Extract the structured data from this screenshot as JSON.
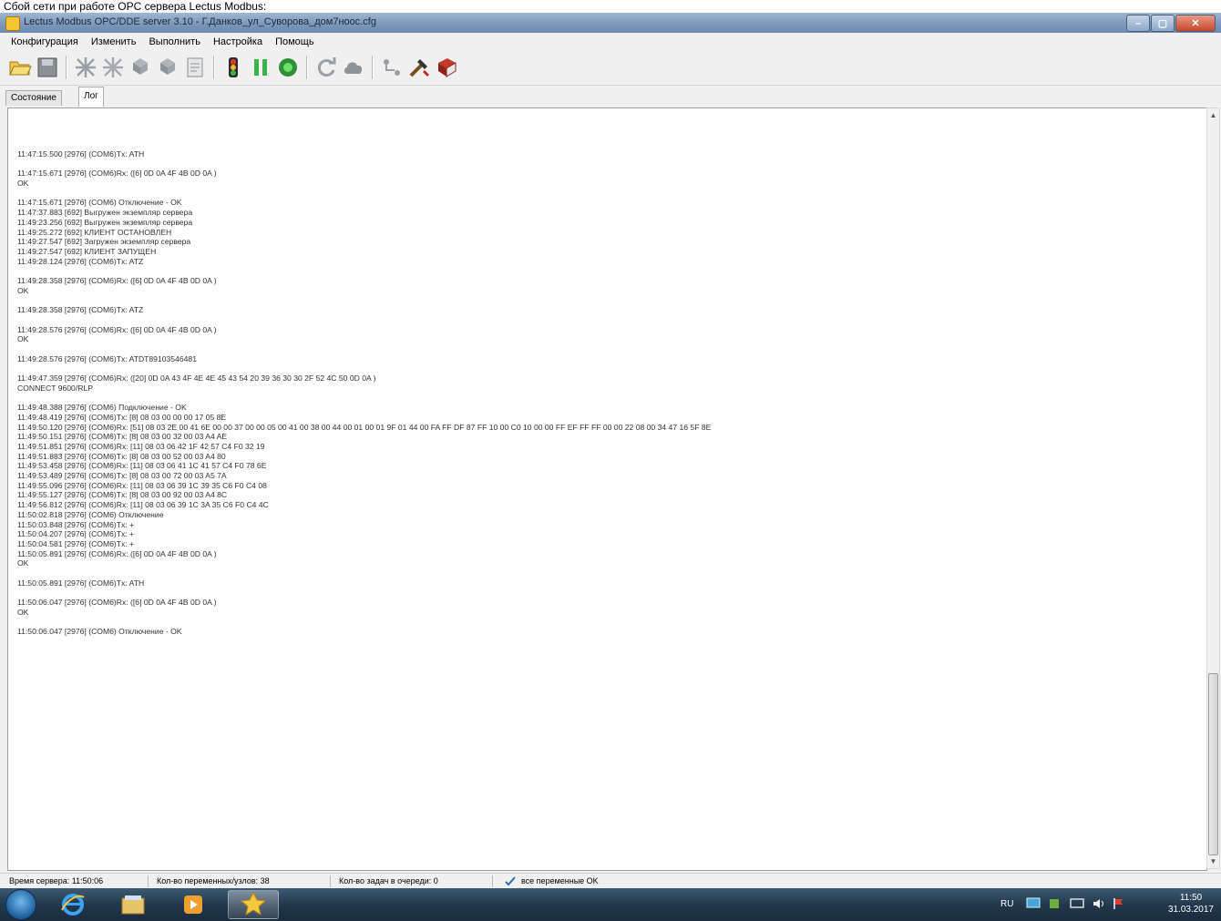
{
  "top_strip_text": "Сбой сети при работе OPC сервера Lectus Modbus:",
  "window": {
    "title": "Lectus Modbus OPC/DDE server 3.10 - Г.Данков_ул_Суворова_дом7ноос.cfg",
    "controls": {
      "minimize": "–",
      "maximize": "▢",
      "close": "✕"
    }
  },
  "menu": [
    "Конфигурация",
    "Изменить",
    "Выполнить",
    "Настройка",
    "Помощь"
  ],
  "toolbar_icons": [
    "open-folder-icon",
    "save-icon",
    "gear-cross-icon",
    "gear-cross-icon-2",
    "device-icon",
    "device-icon-2",
    "report-icon",
    "traffic-light-icon",
    "pause-icon",
    "record-icon",
    "refresh-icon",
    "cloud-icon",
    "network-icon",
    "tools-icon",
    "help-book-icon"
  ],
  "tabs": [
    {
      "label": "Состояние",
      "active": false
    },
    {
      "label": "Лог",
      "active": true
    }
  ],
  "log_lines": [
    "11:47:15.500 [2976] (COM6)Tx: ATH",
    "",
    "11:47:15.671 [2976] (COM6)Rx: ([6] 0D 0A 4F 4B 0D 0A )",
    "OK",
    "",
    "11:47:15.671 [2976] (COM6) Отключение - OK",
    "11:47:37.883 [692] Выгружен экземпляр сервера",
    "11:49:23.256 [692] Выгружен экземпляр сервера",
    "11:49:25.272 [692] КЛИЕНТ ОСТАНОВЛЕН",
    "11:49:27.547 [692] Загружен экземпляр сервера",
    "11:49:27.547 [692] КЛИЕНТ ЗАПУЩЕН",
    "11:49:28.124 [2976] (COM6)Tx: ATZ",
    "",
    "11:49:28.358 [2976] (COM6)Rx: ([6] 0D 0A 4F 4B 0D 0A )",
    "OK",
    "",
    "11:49:28.358 [2976] (COM6)Tx: ATZ",
    "",
    "11:49:28.576 [2976] (COM6)Rx: ([6] 0D 0A 4F 4B 0D 0A )",
    "OK",
    "",
    "11:49:28.576 [2976] (COM6)Tx: ATDT89103546481",
    "",
    "11:49:47.359 [2976] (COM6)Rx: ([20] 0D 0A 43 4F 4E 4E 45 43 54 20 39 36 30 30 2F 52 4C 50 0D 0A )",
    "CONNECT 9600/RLP",
    "",
    "11:49:48.388 [2976] (COM6) Подключение - OK",
    "11:49:48.419 [2976] (COM6)Tx: [8] 08 03 00 00 00 17 05 8E",
    "11:49:50.120 [2976] (COM6)Rx: [51] 08 03 2E 00 41 6E 00 00 37 00 00 05 00 41 00 38 00 44 00 01 00 01 9F 01 44 00 FA FF DF 87 FF 10 00 C0 10 00 00 FF EF FF FF 00 00 22 08 00 34 47 16 5F 8E",
    "11:49:50.151 [2976] (COM6)Tx: [8] 08 03 00 32 00 03 A4 AE",
    "11:49:51.851 [2976] (COM6)Rx: [11] 08 03 06 42 1F 42 57 C4 F0 32 19",
    "11:49:51.883 [2976] (COM6)Tx: [8] 08 03 00 52 00 03 A4 80",
    "11:49:53.458 [2976] (COM6)Rx: [11] 08 03 06 41 1C 41 57 C4 F0 78 6E",
    "11:49:53.489 [2976] (COM6)Tx: [8] 08 03 00 72 00 03 A5 7A",
    "11:49:55.096 [2976] (COM6)Rx: [11] 08 03 06 39 1C 39 35 C6 F0 C4 08",
    "11:49:55.127 [2976] (COM6)Tx: [8] 08 03 00 92 00 03 A4 8C",
    "11:49:56.812 [2976] (COM6)Rx: [11] 08 03 06 39 1C 3A 35 C6 F0 C4 4C",
    "11:50:02.818 [2976] (COM6) Отключение",
    "11:50:03.848 [2976] (COM6)Tx: +",
    "11:50:04.207 [2976] (COM6)Tx: +",
    "11:50:04.581 [2976] (COM6)Tx: +",
    "11:50:05.891 [2976] (COM6)Rx: ([6] 0D 0A 4F 4B 0D 0A )",
    "OK",
    "",
    "11:50:05.891 [2976] (COM6)Tx: ATH",
    "",
    "11:50:06.047 [2976] (COM6)Rx: ([6] 0D 0A 4F 4B 0D 0A )",
    "OK",
    "",
    "11:50:06.047 [2976] (COM6) Отключение - OK"
  ],
  "status": {
    "server_time": "Время сервера: 11:50:06",
    "var_count": "Кол-во переменных/узлов: 38",
    "queue_count": "Кол-во задач в очереди: 0",
    "vars_ok": "все переменные OK"
  },
  "taskbar": {
    "apps": [
      "ie-icon",
      "explorer-folder-icon",
      "media-player-icon",
      "lectus-opc-icon"
    ],
    "tray": {
      "lang": "RU",
      "time": "11:50",
      "date": "31.03.2017"
    }
  },
  "colors": {
    "titlebar": "#7c98bb",
    "log_text": "#333333",
    "taskbar": "#22384d"
  }
}
